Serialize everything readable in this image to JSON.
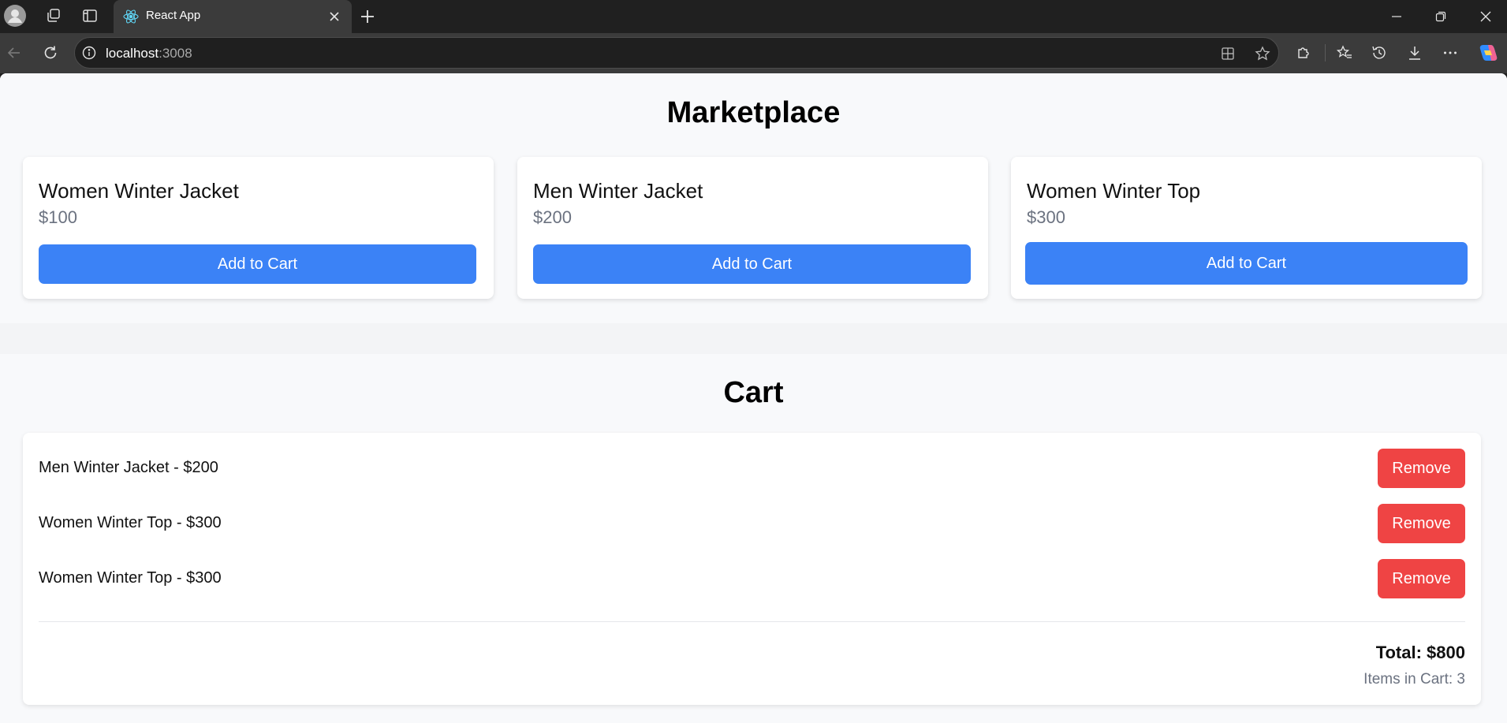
{
  "browser": {
    "tab_title": "React App",
    "url_host": "localhost",
    "url_port": ":3008"
  },
  "marketplace": {
    "title": "Marketplace",
    "products": [
      {
        "name": "Women Winter Jacket",
        "price": "$100",
        "button": "Add to Cart"
      },
      {
        "name": "Men Winter Jacket",
        "price": "$200",
        "button": "Add to Cart"
      },
      {
        "name": "Women Winter Top",
        "price": "$300",
        "button": "Add to Cart"
      }
    ]
  },
  "cart": {
    "title": "Cart",
    "items": [
      {
        "label": "Men Winter Jacket - $200",
        "button": "Remove"
      },
      {
        "label": "Women Winter Top - $300",
        "button": "Remove"
      },
      {
        "label": "Women Winter Top - $300",
        "button": "Remove"
      }
    ],
    "total": "Total: $800",
    "items_count": "Items in Cart: 3"
  },
  "colors": {
    "primary": "#3b82f6",
    "danger": "#ef4444",
    "muted": "#6b7280"
  }
}
